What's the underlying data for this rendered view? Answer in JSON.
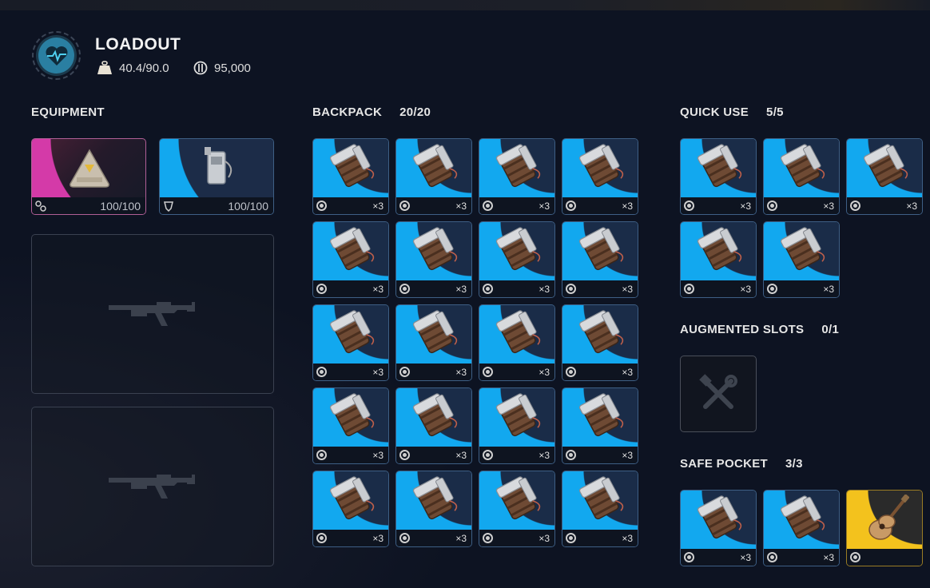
{
  "header": {
    "title": "LOADOUT",
    "weight": "40.4/90.0",
    "currency": "95,000"
  },
  "sections": {
    "equipment": {
      "label": "EQUIPMENT"
    },
    "backpack": {
      "label": "BACKPACK",
      "count": "20/20"
    },
    "quick_use": {
      "label": "QUICK USE",
      "count": "5/5"
    },
    "augmented": {
      "label": "AUGMENTED SLOTS",
      "count": "0/1"
    },
    "safe_pocket": {
      "label": "SAFE POCKET",
      "count": "3/3"
    }
  },
  "equipment": {
    "augment_durability": "100/100",
    "shield_durability": "100/100"
  },
  "item": {
    "quantity": "×3",
    "icon": "grenade-canister-icon"
  },
  "colors": {
    "rarity_blue": "#12a8ef",
    "rarity_pink": "#d43aa8",
    "rarity_gold": "#f3c21d",
    "background": "#0d1322"
  }
}
